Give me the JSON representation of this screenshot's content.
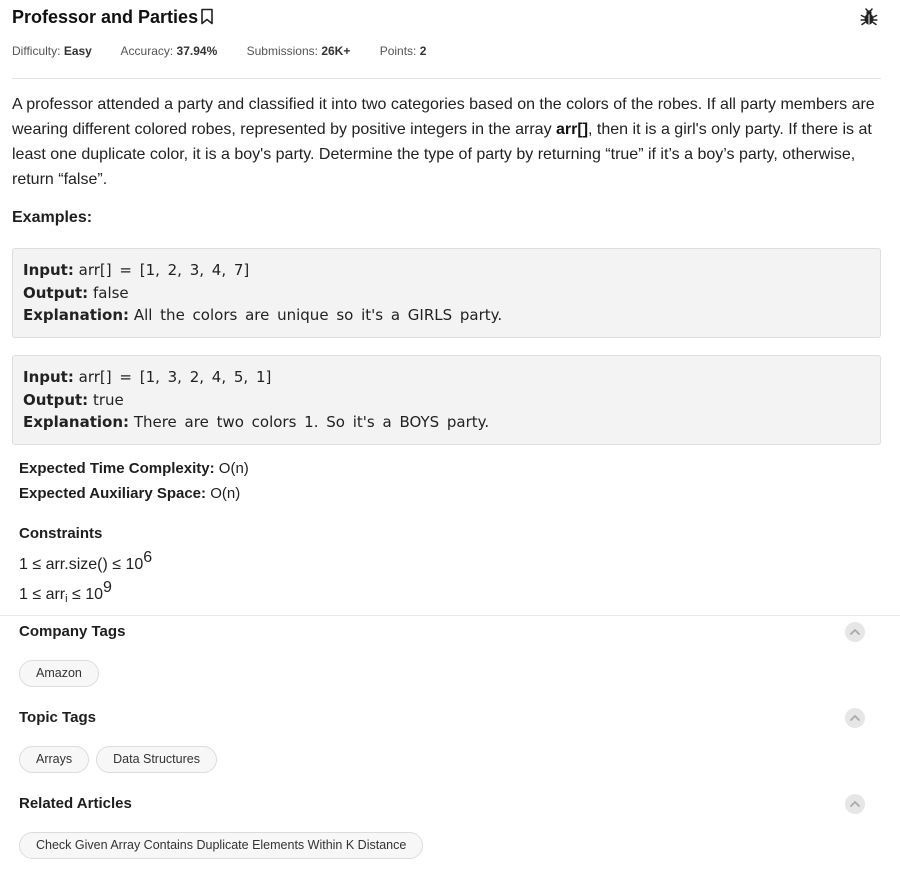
{
  "problem": {
    "title": "Professor and Parties",
    "difficulty_label": "Difficulty:",
    "difficulty": "Easy",
    "accuracy_label": "Accuracy:",
    "accuracy": "37.94%",
    "submissions_label": "Submissions:",
    "submissions": "26K+",
    "points_label": "Points:",
    "points": "2"
  },
  "description": {
    "part1": "A professor attended a party and classified it into two categories based on the colors of the robes. If all party members are wearing different colored robes, represented by positive integers in the array ",
    "highlight": "arr[]",
    "part2": ", then it is a girl's only party. If there is at least one duplicate color, it is a boy's party. Determine the type of party by returning “true” if it’s a boy’s party, otherwise, return “false”."
  },
  "examples_heading": "Examples:",
  "examples": [
    {
      "input_label": "Input:",
      "input": "arr[] = [1, 2, 3, 4, 7]",
      "output_label": "Output:",
      "output": "false",
      "explanation_label": "Explanation:",
      "explanation": "All the colors are unique so it's a GIRLS party."
    },
    {
      "input_label": "Input:",
      "input": "arr[] = [1, 3, 2, 4, 5, 1]",
      "output_label": "Output:",
      "output": "true",
      "explanation_label": "Explanation:",
      "explanation": "There are two colors 1. So it's a BOYS party."
    }
  ],
  "complexity": {
    "time_label": "Expected Time Complexity:",
    "time": "O(n)",
    "space_label": "Expected Auxiliary Space:",
    "space": "O(n)"
  },
  "constraints": {
    "heading": "Constraints",
    "line1_text": "1 ≤ arr.size() ≤ 10",
    "line1_exp": "6",
    "line2_pre": "1 ≤ arr",
    "line2_sub": "i",
    "line2_post": " ≤ 10",
    "line2_exp": "9"
  },
  "sections": {
    "company_tags": {
      "heading": "Company Tags",
      "tags": [
        "Amazon"
      ]
    },
    "topic_tags": {
      "heading": "Topic Tags",
      "tags": [
        "Arrays",
        "Data Structures"
      ]
    },
    "related_articles": {
      "heading": "Related Articles",
      "tags": [
        "Check Given Array Contains Duplicate Elements Within K Distance"
      ]
    }
  },
  "icons": {
    "bookmark": "bookmark-icon",
    "bug": "bug-icon",
    "collapse": "chevron-up-icon"
  }
}
